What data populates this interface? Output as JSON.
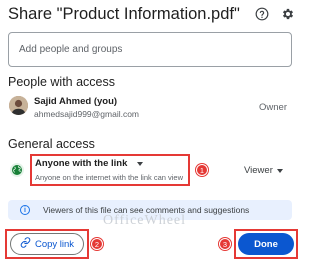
{
  "dialog": {
    "title": "Share \"Product Information.pdf\"",
    "help_icon": "help-circle-icon",
    "settings_icon": "gear-icon"
  },
  "add_people": {
    "placeholder": "Add people and groups"
  },
  "people_with_access": {
    "title": "People with access",
    "people": [
      {
        "name": "Sajid Ahmed (you)",
        "email": "ahmedsajid999@gmail.com",
        "role": "Owner"
      }
    ]
  },
  "general_access": {
    "title": "General access",
    "access_level": "Anyone with the link",
    "description": "Anyone on the internet with the link can view",
    "role": "Viewer",
    "icon": "globe-icon"
  },
  "info_banner": {
    "text": "Viewers of this file can see comments and suggestions",
    "icon": "info-icon"
  },
  "watermark": {
    "text": "OfficeWheel"
  },
  "annotations": {
    "badge1": "1",
    "badge2": "2",
    "badge3": "3",
    "color": "#e53935"
  },
  "buttons": {
    "copy_link": "Copy link",
    "copy_link_icon": "link-icon",
    "done": "Done"
  },
  "colors": {
    "primary": "#0b57d0",
    "banner_bg": "#e8f0fe",
    "globe_bg": "#e6f4ea",
    "annotation": "#e53935"
  }
}
